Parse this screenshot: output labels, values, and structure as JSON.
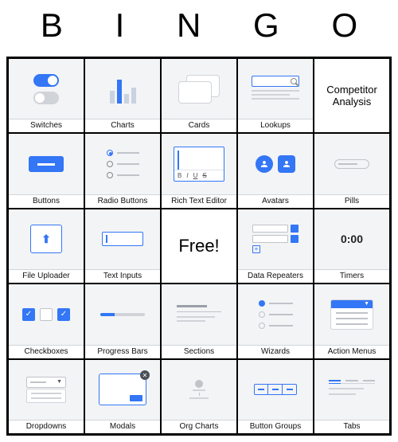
{
  "header": {
    "letters": [
      "B",
      "I",
      "N",
      "G",
      "O"
    ]
  },
  "cells": {
    "r0c0": "Switches",
    "r0c1": "Charts",
    "r0c2": "Cards",
    "r0c3": "Lookups",
    "r0c4": "Competitor Analysis",
    "r1c0": "Buttons",
    "r1c1": "Radio Buttons",
    "r1c2": "Rich Text Editor",
    "r1c3": "Avatars",
    "r1c4": "Pills",
    "r2c0": "File Uploader",
    "r2c1": "Text Inputs",
    "r2c2": "Free!",
    "r2c3": "Data Repeaters",
    "r2c4": "Timers",
    "r3c0": "Checkboxes",
    "r3c1": "Progress Bars",
    "r3c2": "Sections",
    "r3c3": "Wizards",
    "r3c4": "Action Menus",
    "r4c0": "Dropdowns",
    "r4c1": "Modals",
    "r4c2": "Org Charts",
    "r4c3": "Button Groups",
    "r4c4": "Tabs"
  },
  "rte_toolbar": [
    "B",
    "I",
    "U",
    "S"
  ],
  "timer_value": "0:00"
}
